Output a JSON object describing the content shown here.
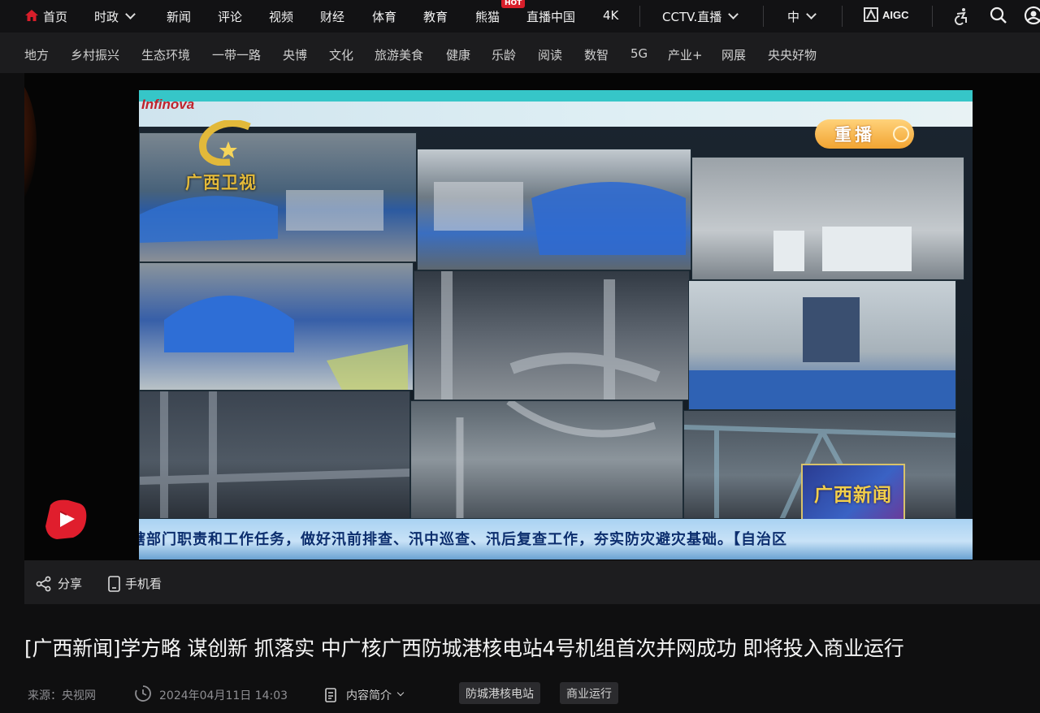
{
  "topnav": {
    "items": [
      "首页",
      "时政",
      "新闻",
      "评论",
      "视频",
      "财经",
      "体育",
      "教育",
      "熊猫",
      "直播中国",
      "4K",
      "CCTV.直播",
      "中"
    ],
    "hot_badge": "HOT",
    "aigc_label": "AIGC",
    "accent_color": "#d81e2a",
    "icons": [
      "home-icon",
      "accessibility-icon",
      "search-icon",
      "user-icon"
    ]
  },
  "subnav": {
    "items": [
      "地方",
      "乡村振兴",
      "生态环境",
      "一带一路",
      "央博",
      "文化",
      "旅游美食",
      "健康",
      "乐龄",
      "阅读",
      "数智",
      "5G",
      "产业+",
      "网展",
      "央央好物"
    ]
  },
  "video": {
    "monitor_brand": "Infinova",
    "channel_logo_text": "广西卫视",
    "replay_badge": "重播",
    "news_badge": "广西新闻",
    "ticker_text": "辖部门职责和工作任务，做好汛前排查、汛中巡查、汛后复查工作，夯实防灾避灾基础。【自治区"
  },
  "toolbar": {
    "share_label": "分享",
    "mobile_label": "手机看"
  },
  "article": {
    "title": "[广西新闻]学方略 谋创新 抓落实 中广核广西防城港核电站4号机组首次并网成功 即将投入商业运行",
    "source": "来源：央视网",
    "date": "2024年04月11日 14:03",
    "summary_label": "内容简介",
    "tags": [
      "防城港核电站",
      "商业运行"
    ]
  }
}
